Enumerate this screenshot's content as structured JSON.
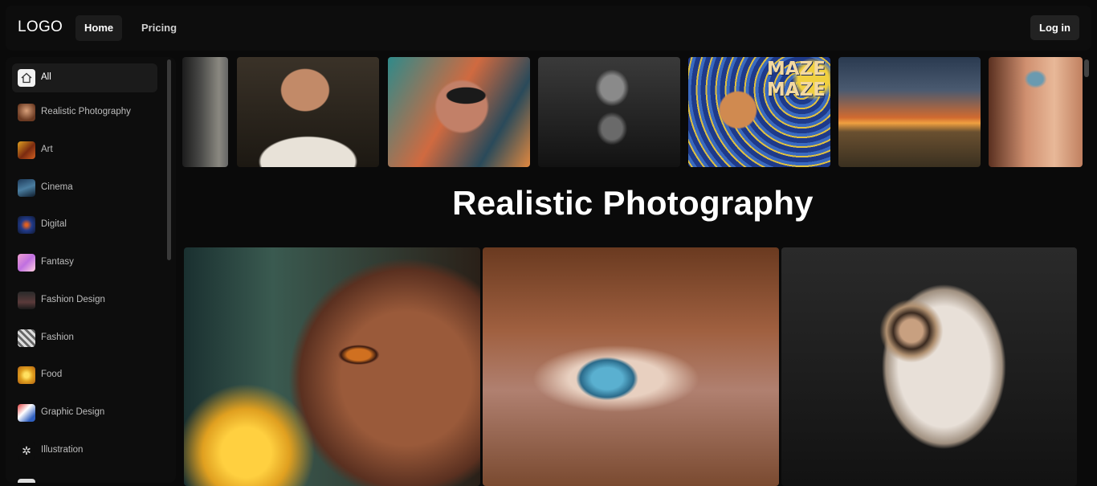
{
  "header": {
    "logo": "LOGO",
    "nav": [
      {
        "label": "Home",
        "active": true
      },
      {
        "label": "Pricing",
        "active": false
      }
    ],
    "login_label": "Log in"
  },
  "sidebar": {
    "items": [
      {
        "label": "All",
        "icon": "home-icon",
        "active": true
      },
      {
        "label": "Realistic Photography",
        "icon": "thumb-portrait"
      },
      {
        "label": "Art",
        "icon": "thumb-art"
      },
      {
        "label": "Cinema",
        "icon": "thumb-cinema"
      },
      {
        "label": "Digital",
        "icon": "thumb-digital"
      },
      {
        "label": "Fantasy",
        "icon": "thumb-fantasy"
      },
      {
        "label": "Fashion Design",
        "icon": "thumb-fashion-design"
      },
      {
        "label": "Fashion",
        "icon": "thumb-fashion"
      },
      {
        "label": "Food",
        "icon": "thumb-food"
      },
      {
        "label": "Graphic Design",
        "icon": "thumb-graphic"
      },
      {
        "label": "Illustration",
        "icon": "thumb-illustration"
      }
    ]
  },
  "strip": {
    "images": [
      {
        "name": "strip-image-partial-portrait"
      },
      {
        "name": "strip-image-bald-man-painting"
      },
      {
        "name": "strip-image-man-sunglasses"
      },
      {
        "name": "strip-image-man-praying"
      },
      {
        "name": "strip-image-van-gogh-maze",
        "text": "MAZE MAZE"
      },
      {
        "name": "strip-image-sunset-landscape"
      },
      {
        "name": "strip-image-woman-freckles"
      }
    ]
  },
  "section": {
    "title": "Realistic Photography"
  },
  "gallery": {
    "images": [
      {
        "name": "gallery-image-girl-face"
      },
      {
        "name": "gallery-image-eye-closeup"
      },
      {
        "name": "gallery-image-robot-head"
      }
    ]
  }
}
